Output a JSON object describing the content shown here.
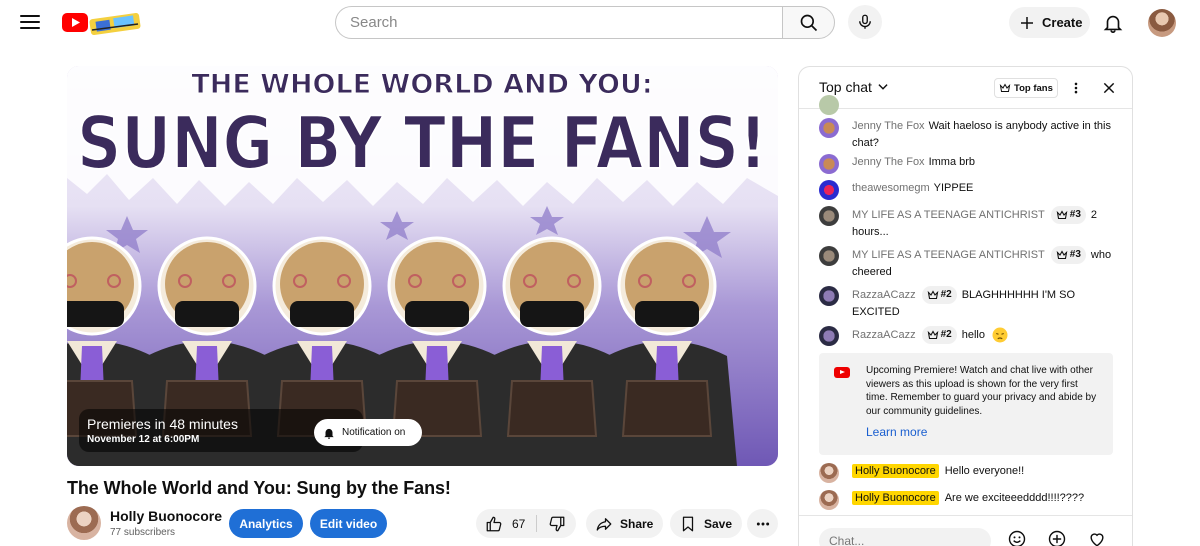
{
  "header": {
    "search_placeholder": "Search",
    "create_label": "Create"
  },
  "video": {
    "thumbnail_line1": "THE WHOLE WORLD AND YOU:",
    "thumbnail_line2": "SUNG BY THE FANS!",
    "premiere_text": "Premieres in 48 minutes",
    "premiere_date": "November 12 at 6:00PM",
    "notification_label": "Notification on",
    "title": "The Whole World and You: Sung by the Fans!",
    "channel_name": "Holly Buonocore",
    "subscribers": "77 subscribers",
    "analytics_label": "Analytics",
    "edit_label": "Edit video",
    "like_count": "67",
    "share_label": "Share",
    "save_label": "Save"
  },
  "chat": {
    "title": "Top chat",
    "top_fans_label": "Top fans",
    "notice": "Upcoming Premiere! Watch and chat live with other viewers as this upload is shown for the very first time. Remember to guard your privacy and abide by our community guidelines.",
    "learn_more": "Learn more",
    "input_placeholder": "Chat...",
    "messages": [
      {
        "author": "Jenny The Fox",
        "text": "Wait haeloso is anybody active in this chat?"
      },
      {
        "author": "Jenny The Fox",
        "text": "Imma brb"
      },
      {
        "author": "theawesomegm",
        "text": "YIPPEE"
      },
      {
        "author": "MY LIFE AS A TEENAGE ANTICHRIST",
        "badge": "#3",
        "text": "2 hours..."
      },
      {
        "author": "MY LIFE AS A TEENAGE ANTICHRIST",
        "badge": "#3",
        "text": "who cheered"
      },
      {
        "author": "RazzaACazz",
        "badge": "#2",
        "text": "BLAGHHHHHH I'M SO EXCITED"
      },
      {
        "author": "RazzaACazz",
        "badge": "#2",
        "text": "hello"
      },
      {
        "author": "Holly Buonocore",
        "text": "Hello everyone!!"
      },
      {
        "author": "Holly Buonocore",
        "text": "Are we exciteeedddd!!!!????"
      }
    ]
  }
}
